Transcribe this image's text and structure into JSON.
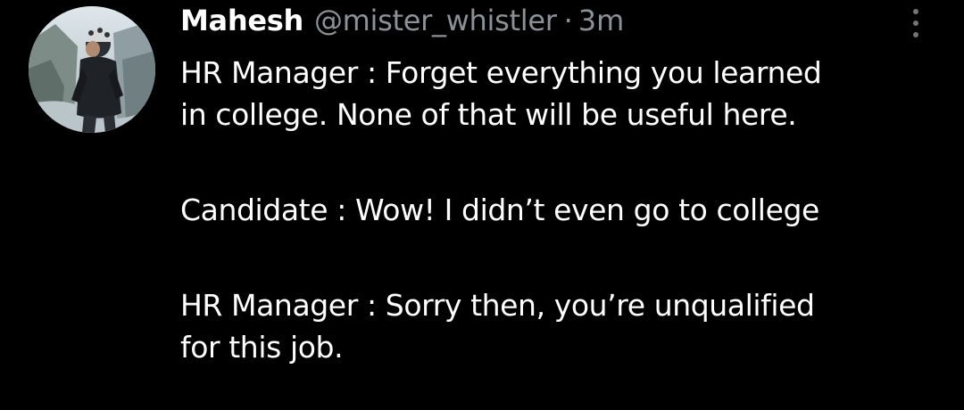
{
  "tweet": {
    "author_name": "Mahesh",
    "handle": "@mister_whistler",
    "separator": "·",
    "time": "3m",
    "avatar_icon": "profile-photo",
    "more_icon": "more-vertical-icon",
    "lines": [
      "HR Manager : Forget everything you learned",
      "in college. None of that will be useful here.",
      "Candidate : Wow! I didn’t even go to college",
      "HR Manager : Sorry then, you’re unqualified",
      "for this job."
    ]
  },
  "colors": {
    "background": "#000000",
    "text": "#ffffff",
    "secondary_text": "#8b9196"
  }
}
